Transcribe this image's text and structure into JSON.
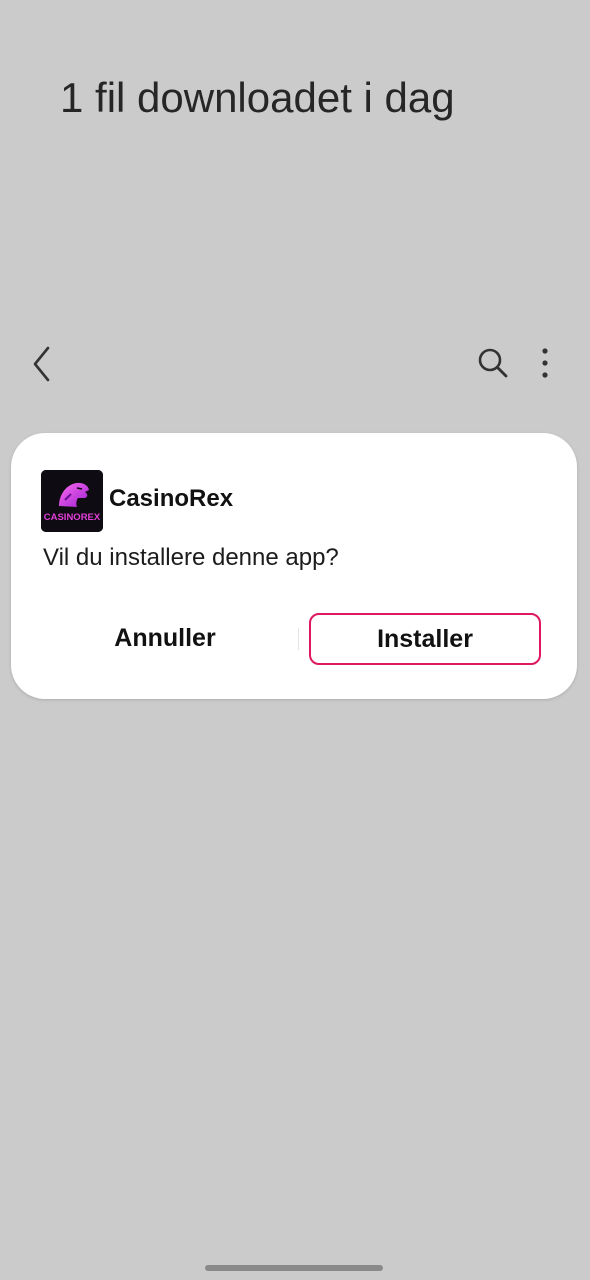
{
  "header": {
    "title": "1 fil downloadet i dag"
  },
  "toolbar": {
    "back_icon": "chevron-left-icon",
    "search_icon": "search-icon",
    "more_icon": "more-vertical-icon"
  },
  "dialog": {
    "app_icon": "casinorex-logo",
    "app_icon_text": "CASINOREX",
    "app_name": "CasinoRex",
    "question": "Vil du installere denne app?",
    "cancel_label": "Annuller",
    "install_label": "Installer"
  },
  "colors": {
    "background": "#cbcbcb",
    "dialog": "#ffffff",
    "install_border": "#e0185f",
    "logo_magenta": "#e040d8"
  }
}
